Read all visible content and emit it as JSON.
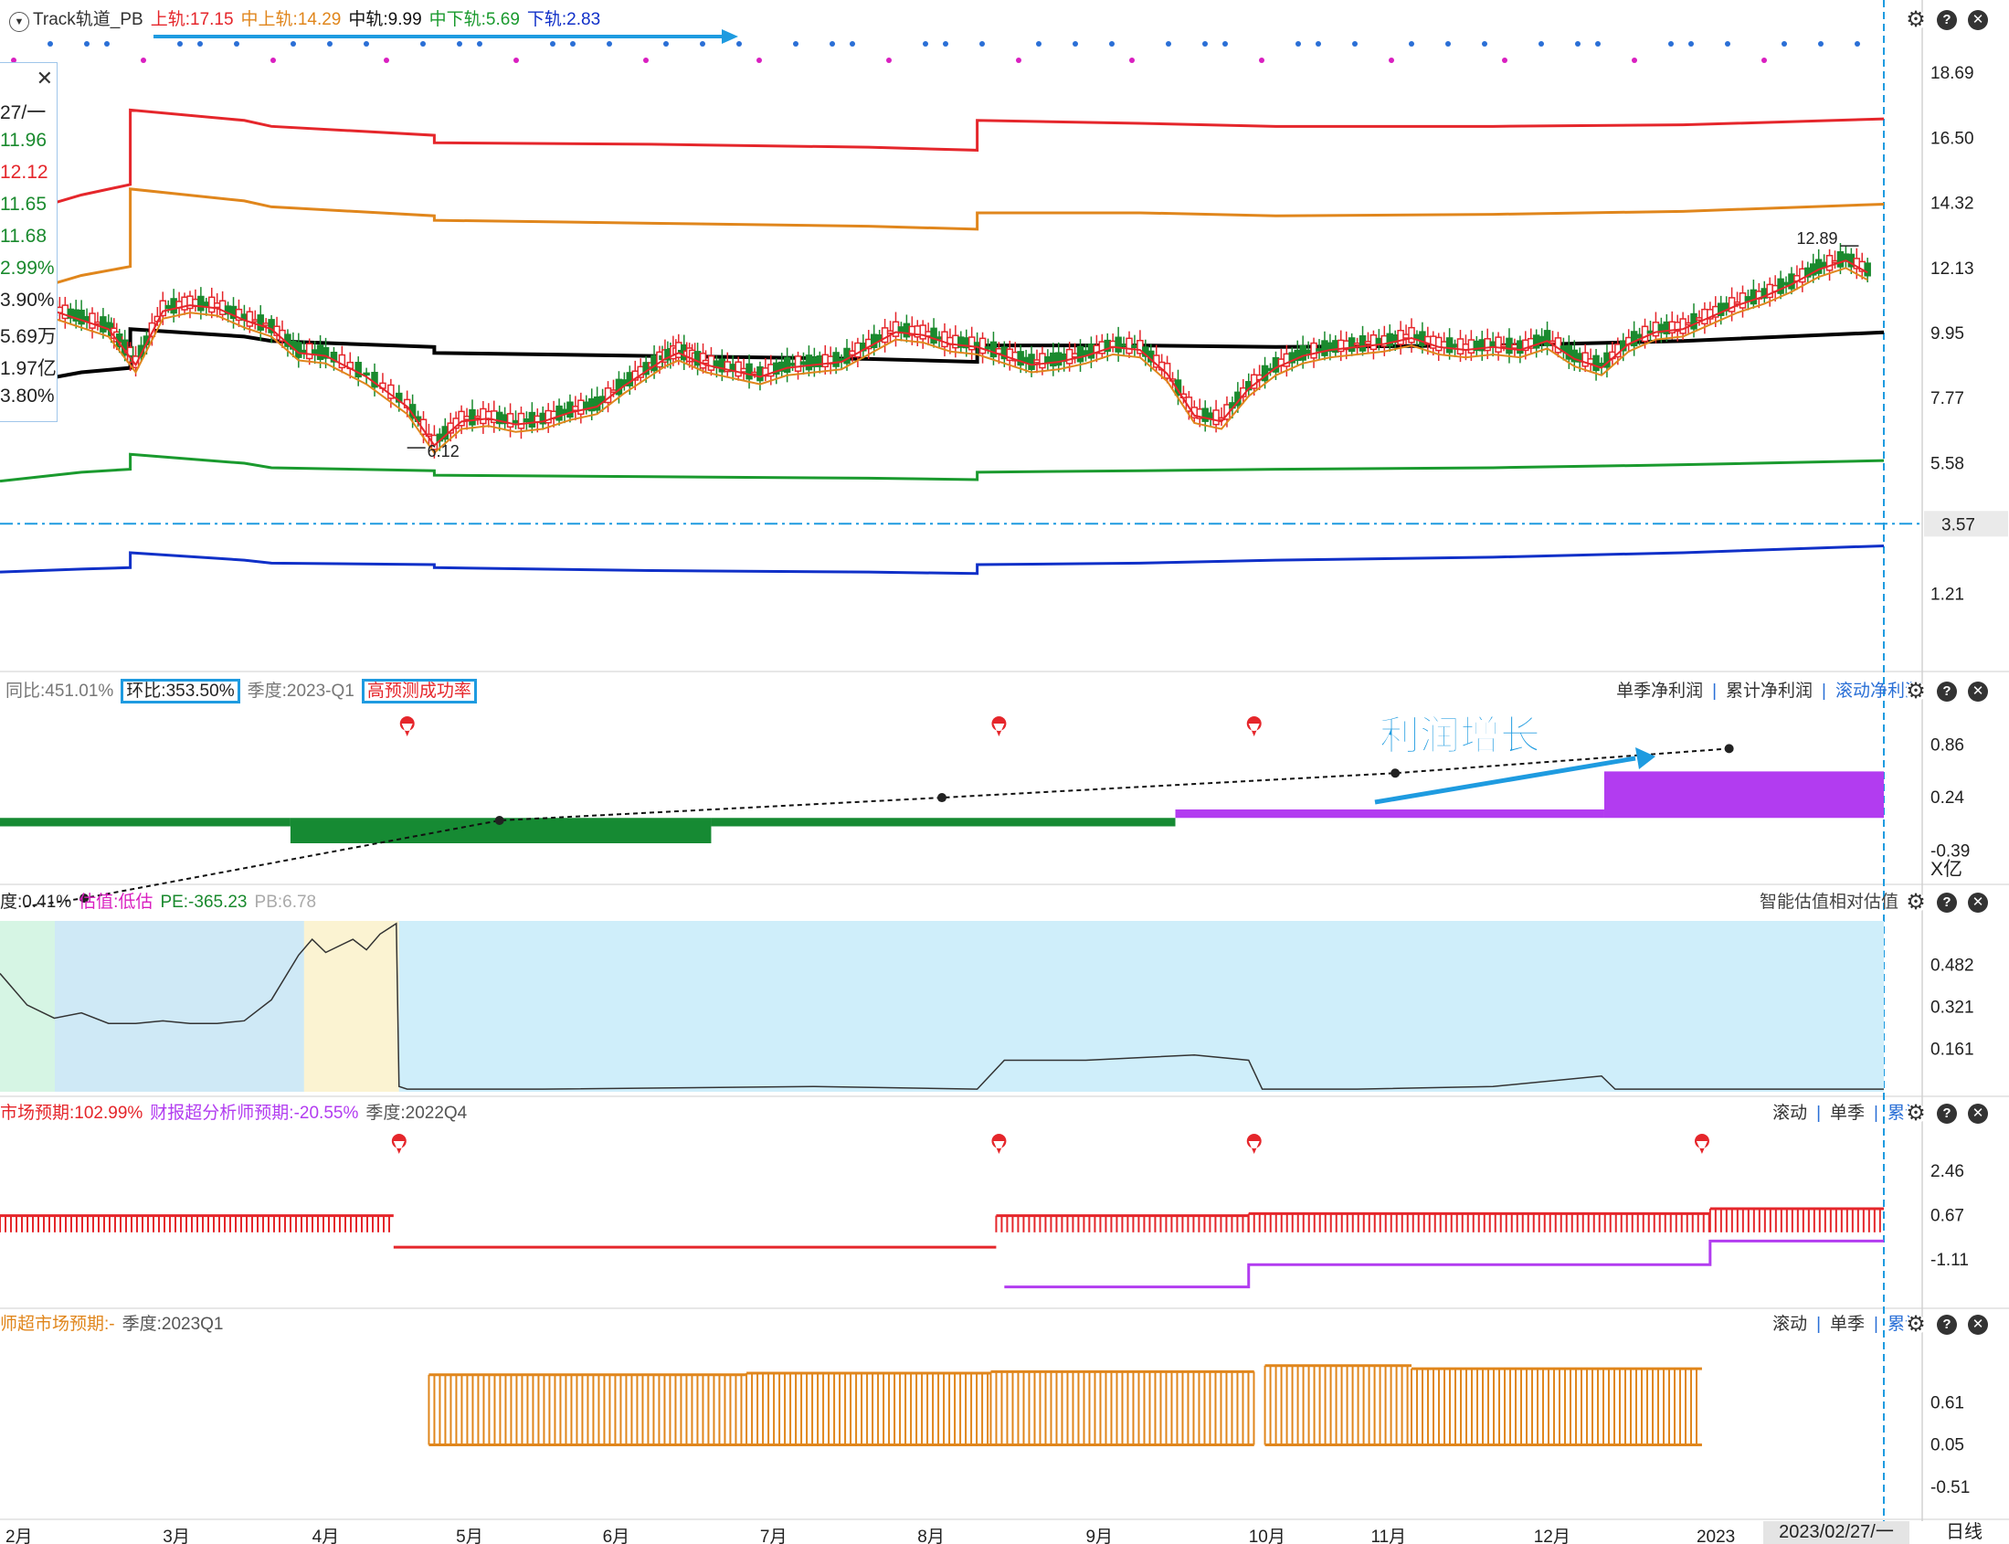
{
  "header": {
    "indicator": "Track轨道_PB",
    "upper": "上轨:17.15",
    "mid_upper": "中上轨:14.29",
    "mid": "中轨:9.99",
    "mid_lower": "中下轨:5.69",
    "lower": "下轨:2.83"
  },
  "info_box": {
    "rows": [
      "27/一",
      "11.96",
      "12.12",
      "11.65",
      "11.68",
      "2.99%",
      "3.90%",
      "5.69万",
      "1.97亿",
      "3.80%"
    ],
    "colors": [
      "#222222",
      "#1a8a2e",
      "#e5262b",
      "#1a8a2e",
      "#1a8a2e",
      "#1a8a2e",
      "#222222",
      "#222222",
      "#222222",
      "#222222"
    ]
  },
  "panel_profit": {
    "yoy": "同比:451.01%",
    "qoq": "环比:353.50%",
    "season": "季度:2023-Q1",
    "success": "高预测成功率",
    "menu": [
      "单季净利润",
      "累计净利润",
      "滚动净利润"
    ],
    "annotation": "利润增长",
    "unit": "X亿"
  },
  "panel_valuation": {
    "percentile": "度:0.41%",
    "valuation": "估值:低估",
    "pe": "PE:-365.23",
    "pb": "PB:6.78",
    "title": "智能估值相对估值"
  },
  "panel_expect": {
    "market": "市场预期:102.99%",
    "analyst": "财报超分析师预期:-20.55%",
    "season": "季度:2022Q4",
    "menu": [
      "滚动",
      "单季",
      "累计"
    ]
  },
  "panel_analyst": {
    "market": "师超市场预期:-",
    "season": "季度:2023Q1",
    "menu": [
      "滚动",
      "单季",
      "累计"
    ]
  },
  "footer": {
    "date": "2023/02/27/一",
    "period": "日线"
  },
  "colors": {
    "upper": "#e5262b",
    "mid_upper": "#e0861c",
    "mid": "#000000",
    "mid_lower": "#1a9a2e",
    "lower": "#1030c8",
    "accent": "#1e9be0",
    "up_candle": "#e5262b",
    "down_candle": "#1a8a2e",
    "purple": "#b23cf0",
    "orange_bar": "#e0861c"
  },
  "chart_data": [
    {
      "type": "line",
      "title": "Track轨道_PB",
      "x_ticks": [
        "2月",
        "3月",
        "4月",
        "5月",
        "6月",
        "7月",
        "8月",
        "9月",
        "10月",
        "11月",
        "12月",
        "2023"
      ],
      "y_ticks": [
        18.69,
        16.5,
        14.32,
        12.13,
        9.95,
        7.77,
        5.58,
        3.57,
        1.21
      ],
      "ylim": [
        0.3,
        19.3
      ],
      "series": [
        {
          "name": "上轨:17.15",
          "x": [
            0,
            0.15,
            0.3,
            0.48,
            0.48,
            0.9,
            1.0,
            1.6,
            1.6,
            2.4,
            3.2,
            3.6,
            3.6,
            4.2,
            4.7,
            5.5,
            6.2,
            6.94
          ],
          "y": [
            13.8,
            14.2,
            14.6,
            14.95,
            17.45,
            17.1,
            16.9,
            16.6,
            16.35,
            16.3,
            16.2,
            16.1,
            17.1,
            17.0,
            16.9,
            16.9,
            16.95,
            17.15
          ]
        },
        {
          "name": "中上轨:14.29",
          "x": [
            0,
            0.15,
            0.3,
            0.48,
            0.48,
            0.9,
            1.0,
            1.6,
            1.6,
            2.4,
            3.2,
            3.6,
            3.6,
            4.2,
            4.7,
            5.5,
            6.2,
            6.94
          ],
          "y": [
            11.1,
            11.5,
            11.9,
            12.2,
            14.8,
            14.4,
            14.2,
            13.9,
            13.75,
            13.65,
            13.55,
            13.45,
            14.0,
            14.0,
            13.9,
            13.95,
            14.05,
            14.29
          ]
        },
        {
          "name": "中轨:9.99",
          "x": [
            0,
            0.15,
            0.3,
            0.48,
            0.48,
            0.9,
            1.0,
            1.6,
            1.6,
            2.4,
            3.2,
            3.6,
            3.6,
            4.2,
            4.7,
            5.5,
            6.2,
            6.94
          ],
          "y": [
            8.1,
            8.4,
            8.65,
            8.8,
            10.1,
            9.85,
            9.7,
            9.5,
            9.3,
            9.2,
            9.1,
            9.0,
            9.55,
            9.55,
            9.5,
            9.55,
            9.7,
            9.99
          ]
        },
        {
          "name": "中下轨:5.69",
          "x": [
            0,
            0.15,
            0.3,
            0.48,
            0.48,
            0.9,
            1.0,
            1.6,
            1.6,
            2.4,
            3.2,
            3.6,
            3.6,
            4.2,
            4.7,
            5.5,
            6.2,
            6.94
          ],
          "y": [
            5.0,
            5.15,
            5.3,
            5.4,
            5.9,
            5.6,
            5.45,
            5.35,
            5.2,
            5.15,
            5.1,
            5.05,
            5.3,
            5.35,
            5.4,
            5.45,
            5.55,
            5.69
          ]
        },
        {
          "name": "下轨:2.83",
          "x": [
            0,
            0.15,
            0.3,
            0.48,
            0.48,
            0.9,
            1.0,
            1.6,
            1.6,
            2.4,
            3.2,
            3.6,
            3.6,
            4.2,
            4.7,
            5.5,
            6.2,
            6.94
          ],
          "y": [
            1.95,
            2.0,
            2.05,
            2.1,
            2.6,
            2.35,
            2.25,
            2.2,
            2.1,
            2.0,
            1.95,
            1.9,
            2.2,
            2.25,
            2.35,
            2.45,
            2.6,
            2.83
          ]
        }
      ],
      "price": {
        "x": [
          0,
          0.1,
          0.2,
          0.3,
          0.4,
          0.45,
          0.5,
          0.6,
          0.7,
          0.8,
          0.9,
          1.0,
          1.1,
          1.2,
          1.35,
          1.5,
          1.6,
          1.7,
          1.8,
          1.9,
          2.0,
          2.1,
          2.2,
          2.3,
          2.4,
          2.45,
          2.5,
          2.55,
          2.6,
          2.7,
          2.8,
          2.9,
          3.0,
          3.1,
          3.2,
          3.3,
          3.4,
          3.5,
          3.6,
          3.7,
          3.8,
          3.9,
          4.0,
          4.1,
          4.2,
          4.3,
          4.4,
          4.5,
          4.6,
          4.7,
          4.8,
          4.9,
          5.0,
          5.1,
          5.2,
          5.3,
          5.4,
          5.5,
          5.6,
          5.7,
          5.8,
          5.9,
          6.0,
          6.1,
          6.2,
          6.3,
          6.4,
          6.5,
          6.6,
          6.7,
          6.8,
          6.9
        ],
        "y": [
          10.3,
          11.3,
          10.8,
          10.5,
          10.2,
          9.6,
          9.0,
          10.8,
          11.0,
          10.9,
          10.5,
          10.2,
          9.4,
          9.3,
          8.6,
          7.6,
          6.3,
          7.1,
          7.2,
          7.0,
          7.1,
          7.4,
          7.6,
          8.3,
          8.9,
          9.2,
          9.4,
          9.2,
          9.0,
          8.8,
          8.6,
          8.9,
          9.0,
          9.1,
          9.6,
          10.1,
          10.0,
          9.7,
          9.6,
          9.3,
          9.0,
          9.1,
          9.3,
          9.6,
          9.5,
          8.7,
          7.3,
          7.1,
          8.2,
          8.9,
          9.3,
          9.5,
          9.6,
          9.7,
          9.9,
          9.6,
          9.5,
          9.6,
          9.5,
          9.8,
          9.2,
          8.9,
          9.7,
          10.1,
          10.2,
          10.6,
          11.0,
          11.3,
          11.7,
          12.2,
          12.5,
          12.0
        ],
        "markers": [
          {
            "label": "12.89",
            "x": 6.78,
            "y": 12.89
          },
          {
            "label": "6.12",
            "x": 1.5,
            "y": 6.12
          }
        ]
      },
      "dashed_level": 3.57
    },
    {
      "type": "bar",
      "title": "单季净利润",
      "unit": "X亿",
      "y_ticks": [
        0.86,
        0.24,
        -0.39
      ],
      "ylim": [
        -0.7,
        1.3
      ],
      "segments": [
        {
          "x0": 0.0,
          "x1": 1.07,
          "value": -0.1,
          "color": "green"
        },
        {
          "x0": 1.07,
          "x1": 2.62,
          "value": -0.3,
          "color": "green"
        },
        {
          "x0": 2.62,
          "x1": 4.33,
          "value": -0.1,
          "color": "green"
        },
        {
          "x0": 4.33,
          "x1": 5.91,
          "value": 0.1,
          "color": "purple"
        },
        {
          "x0": 5.91,
          "x1": 6.94,
          "value": 0.55,
          "color": "purple"
        }
      ],
      "trend": {
        "x": [
          0.31,
          1.84,
          3.47,
          5.14,
          6.37
        ],
        "y": [
          -0.95,
          -0.03,
          0.24,
          0.53,
          0.82
        ]
      }
    },
    {
      "type": "area",
      "title": "智能估值相对估值",
      "y_ticks": [
        0.482,
        0.321,
        0.161
      ],
      "ylim": [
        0,
        0.65
      ],
      "x": [
        0,
        0.1,
        0.2,
        0.3,
        0.4,
        0.5,
        0.6,
        0.7,
        0.8,
        0.9,
        1.0,
        1.1,
        1.15,
        1.2,
        1.3,
        1.35,
        1.4,
        1.46,
        1.47,
        1.5,
        2.0,
        3.0,
        3.6,
        3.7,
        4.0,
        4.4,
        4.6,
        4.65,
        5.0,
        5.5,
        5.9,
        5.95,
        6.5,
        6.94
      ],
      "y": [
        0.45,
        0.33,
        0.28,
        0.3,
        0.26,
        0.26,
        0.27,
        0.26,
        0.26,
        0.27,
        0.35,
        0.52,
        0.58,
        0.53,
        0.58,
        0.54,
        0.6,
        0.64,
        0.02,
        0.01,
        0.01,
        0.02,
        0.01,
        0.12,
        0.12,
        0.14,
        0.12,
        0.01,
        0.01,
        0.02,
        0.06,
        0.01,
        0.01,
        0.01
      ]
    },
    {
      "type": "bar",
      "title": "市场预期",
      "y_ticks": [
        2.46,
        0.67,
        -1.11
      ],
      "ylim": [
        -2.8,
        4.0
      ],
      "segments": [
        {
          "x0": 0.0,
          "x1": 1.45,
          "value": 0.67,
          "color": "red"
        },
        {
          "x0": 1.45,
          "x1": 3.67,
          "value": -0.6,
          "color": "red_line"
        },
        {
          "x0": 3.67,
          "x1": 4.6,
          "value": 0.67,
          "color": "red"
        },
        {
          "x0": 4.6,
          "x1": 6.3,
          "value": 0.75,
          "color": "red"
        },
        {
          "x0": 6.3,
          "x1": 6.94,
          "value": 0.95,
          "color": "red"
        }
      ],
      "purple_line": {
        "x": [
          3.7,
          4.6,
          4.6,
          6.3,
          6.3,
          6.94
        ],
        "y": [
          -2.2,
          -2.2,
          -1.3,
          -1.3,
          -0.35,
          -0.35
        ]
      }
    },
    {
      "type": "bar",
      "title": "师超市场预期",
      "y_ticks": [
        0.61,
        0.05,
        -0.51
      ],
      "ylim": [
        -0.9,
        1.4
      ],
      "segments": [
        {
          "x0": 1.58,
          "x1": 2.75,
          "value": 0.98
        },
        {
          "x0": 2.75,
          "x1": 3.65,
          "value": 1.0
        },
        {
          "x0": 3.65,
          "x1": 4.62,
          "value": 1.02
        },
        {
          "x0": 4.66,
          "x1": 5.2,
          "value": 1.1
        },
        {
          "x0": 5.2,
          "x1": 6.27,
          "value": 1.06
        }
      ],
      "baseline": 0.05
    }
  ]
}
